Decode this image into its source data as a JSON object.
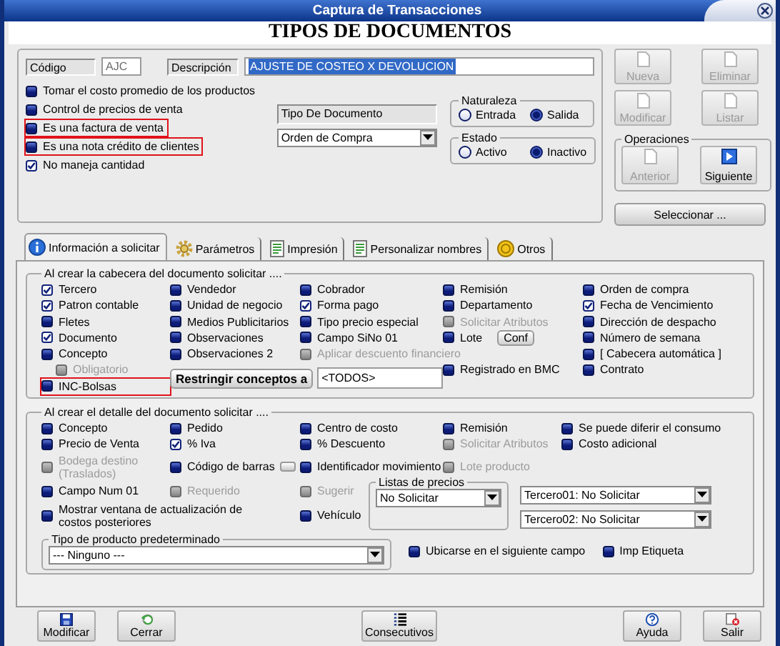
{
  "window": {
    "title": "Captura de Transacciones"
  },
  "heading": "TIPOS DE DOCUMENTOS",
  "code": {
    "label": "Código",
    "value": "AJC"
  },
  "description": {
    "label": "Descripción",
    "value": "AJUSTE DE COSTEO X DEVOLUCION",
    "text_selected": true
  },
  "options": [
    {
      "label": "Tomar el costo promedio de los productos",
      "checked": false,
      "highlighted": false
    },
    {
      "label": "Control de precios de venta",
      "checked": false,
      "highlighted": false
    },
    {
      "label": "Es una factura de venta",
      "checked": false,
      "highlighted": true
    },
    {
      "label": "Es una nota crédito de clientes",
      "checked": false,
      "highlighted": true
    },
    {
      "label": "No maneja cantidad",
      "checked": true,
      "highlighted": false
    }
  ],
  "document_type": {
    "label": "Tipo De Documento",
    "value": "Orden de Compra"
  },
  "nature": {
    "title": "Naturaleza",
    "options": [
      {
        "label": "Entrada",
        "selected": false
      },
      {
        "label": "Salida",
        "selected": true
      }
    ]
  },
  "status": {
    "title": "Estado",
    "options": [
      {
        "label": "Activo",
        "selected": false
      },
      {
        "label": "Inactivo",
        "selected": true
      }
    ]
  },
  "record_buttons": [
    {
      "label": "Nueva",
      "disabled": true
    },
    {
      "label": "Eliminar",
      "disabled": true
    },
    {
      "label": "Modificar",
      "disabled": true
    },
    {
      "label": "Listar",
      "disabled": true
    }
  ],
  "operations": {
    "title": "Operaciones",
    "buttons": [
      {
        "label": "Anterior",
        "disabled": true
      },
      {
        "label": "Siguiente",
        "disabled": false
      }
    ]
  },
  "select_button": "Seleccionar ...",
  "tabs": [
    {
      "label": "Información a solicitar",
      "selected": true,
      "kind": "info"
    },
    {
      "label": "Parámetros",
      "selected": false,
      "kind": "gear"
    },
    {
      "label": "Impresión",
      "selected": false,
      "kind": "sheet"
    },
    {
      "label": "Personalizar nombres",
      "selected": false,
      "kind": "sheet"
    },
    {
      "label": "Otros",
      "selected": false,
      "kind": "coin"
    }
  ],
  "header_group": {
    "title": "Al crear la cabecera del documento solicitar ....",
    "columns": [
      [
        {
          "label": "Tercero",
          "checked": true,
          "disabled": false
        },
        {
          "label": "Patron contable",
          "checked": true,
          "disabled": false
        },
        {
          "label": "Fletes",
          "checked": false,
          "disabled": false
        },
        {
          "label": "Documento",
          "checked": true,
          "disabled": false
        },
        {
          "label": "Concepto",
          "checked": false,
          "disabled": false
        }
      ],
      [
        {
          "label": "Vendedor",
          "checked": false,
          "disabled": false
        },
        {
          "label": "Unidad de negocio",
          "checked": false,
          "disabled": false
        },
        {
          "label": "Medios Publicitarios",
          "checked": false,
          "disabled": false
        },
        {
          "label": "Observaciones",
          "checked": false,
          "disabled": false
        },
        {
          "label": "Observaciones 2",
          "checked": false,
          "disabled": false
        }
      ],
      [
        {
          "label": "Cobrador",
          "checked": false,
          "disabled": false
        },
        {
          "label": "Forma pago",
          "checked": true,
          "disabled": false
        },
        {
          "label": "Tipo precio especial",
          "checked": false,
          "disabled": false
        },
        {
          "label": "Campo SiNo 01",
          "checked": false,
          "disabled": false
        },
        {
          "label": "Aplicar descuento financiero",
          "checked": false,
          "disabled": true
        }
      ],
      [
        {
          "label": "Remisión",
          "checked": false,
          "disabled": false
        },
        {
          "label": "Departamento",
          "checked": false,
          "disabled": false
        },
        {
          "label": "Solicitar Atributos",
          "checked": false,
          "disabled": true
        },
        {
          "label": "Lote",
          "checked": false,
          "disabled": false,
          "button": "Conf"
        }
      ],
      [
        {
          "label": "Orden de compra",
          "checked": false,
          "disabled": false
        },
        {
          "label": "Fecha de Vencimiento",
          "checked": true,
          "disabled": false
        },
        {
          "label": "Dirección de despacho",
          "checked": false,
          "disabled": false
        },
        {
          "label": "Número de semana",
          "checked": false,
          "disabled": false
        },
        {
          "label": "[ Cabecera automática ]",
          "checked": false,
          "disabled": false
        },
        {
          "label": "Contrato",
          "checked": false,
          "disabled": false
        }
      ]
    ],
    "required": {
      "label": "Obligatorio",
      "checked": false,
      "disabled": true
    },
    "bags": {
      "label": "INC-Bolsas",
      "checked": false,
      "disabled": false,
      "highlighted": true
    },
    "restrict": {
      "button": "Restringir conceptos a",
      "value": "<TODOS>"
    },
    "bmc": {
      "label": "Registrado en BMC",
      "checked": false,
      "disabled": false
    }
  },
  "detail_group": {
    "title": "Al crear  el detalle del documento solicitar ....",
    "rows": [
      [
        {
          "label": "Concepto",
          "checked": false,
          "disabled": false
        },
        {
          "label": "Pedido",
          "checked": false,
          "disabled": false
        },
        {
          "label": "Centro de costo",
          "checked": false,
          "disabled": false
        },
        {
          "label": "Remisión",
          "checked": false,
          "disabled": false
        },
        {
          "label": "Se puede diferir el consumo",
          "checked": false,
          "disabled": false
        }
      ],
      [
        {
          "label": "Precio de Venta",
          "checked": false,
          "disabled": false
        },
        {
          "label": "% Iva",
          "checked": true,
          "disabled": false
        },
        {
          "label": "% Descuento",
          "checked": false,
          "disabled": false
        },
        {
          "label": "Solicitar Atributos",
          "checked": false,
          "disabled": true
        },
        {
          "label": "Costo adicional",
          "checked": false,
          "disabled": false
        }
      ],
      [
        {
          "label": "Bodega destino (Traslados)",
          "checked": false,
          "disabled": true
        },
        {
          "label": "Código de barras",
          "checked": false,
          "disabled": false
        },
        {
          "label": "Identificador movimiento",
          "checked": false,
          "disabled": false
        },
        {
          "label": "Lote producto",
          "checked": false,
          "disabled": true
        }
      ]
    ],
    "num_field": {
      "label": "Campo Num 01",
      "checked": false,
      "disabled": false
    },
    "required": {
      "label": "Requerido",
      "checked": false,
      "disabled": true
    },
    "suggest": {
      "label": "Sugerir",
      "checked": false,
      "disabled": true
    },
    "refresh": {
      "label": "Mostrar ventana de actualización de costos posteriores",
      "checked": false,
      "disabled": false
    },
    "vehicle": {
      "label": "Vehículo",
      "checked": false,
      "disabled": false
    },
    "price_lists": {
      "title": "Listas de precios",
      "value": "No Solicitar"
    },
    "third_parties": [
      "Tercero01: No Solicitar",
      "Tercero02: No Solicitar"
    ],
    "product_type": {
      "title": "Tipo de producto predeterminado",
      "value": "--- Ninguno ---"
    },
    "next_field": {
      "label": "Ubicarse en el siguiente campo",
      "checked": false,
      "disabled": false
    },
    "label_print": {
      "label": "Imp Etiqueta",
      "checked": false,
      "disabled": false
    }
  },
  "footer_buttons": [
    {
      "label": "Modificar",
      "kind": "save"
    },
    {
      "label": "Cerrar",
      "kind": "undo"
    },
    {
      "label": "Consecutivos",
      "kind": "list"
    },
    {
      "label": "Ayuda",
      "kind": "help"
    },
    {
      "label": "Salir",
      "kind": "exit"
    }
  ]
}
